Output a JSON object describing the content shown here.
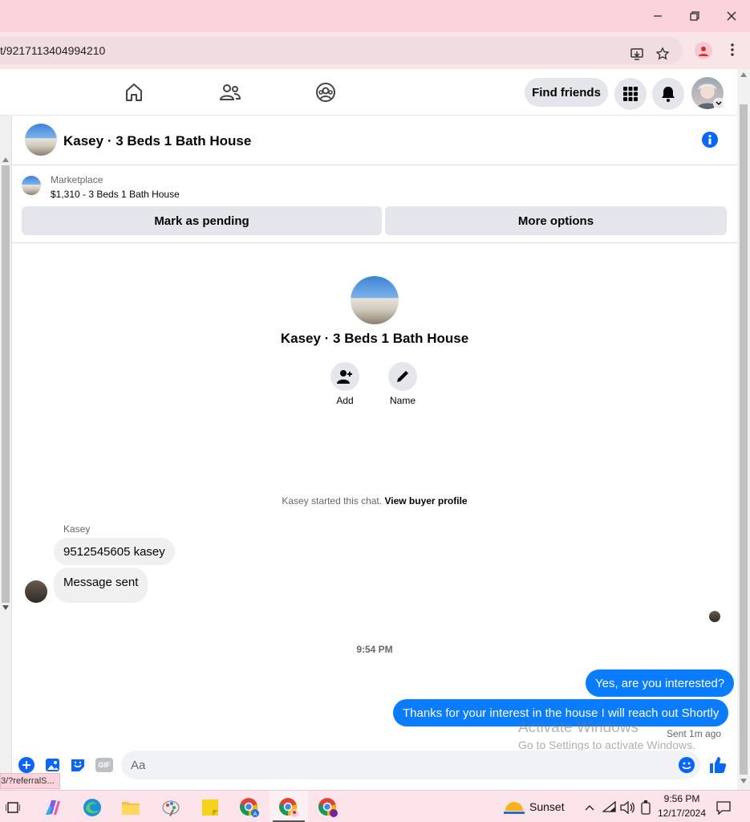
{
  "browser": {
    "url": "t/9217113404994210",
    "status_link": "3/?referralS..."
  },
  "fbnav": {
    "find_friends": "Find friends"
  },
  "chat": {
    "title": "Kasey · 3 Beds 1 Bath House",
    "marketplace_label": "Marketplace",
    "listing": "$1,310 - 3 Beds 1 Bath House",
    "mark_pending": "Mark as pending",
    "more_options": "More options",
    "profile_name": "Kasey · 3 Beds 1 Bath House",
    "add_label": "Add",
    "name_label": "Name",
    "started_text": "Kasey started this chat.",
    "view_buyer": "View buyer profile",
    "sender_name": "Kasey",
    "messages_in": [
      "9512545605 kasey",
      "Message sent"
    ],
    "time_divider": "9:54 PM",
    "messages_out": [
      "Yes, are you interested?",
      "Thanks for your interest in the house I will reach out Shortly"
    ],
    "sent_status": "Sent 1m ago",
    "composer_placeholder": "Aa"
  },
  "watermark": {
    "line1": "Activate Windows",
    "line2": "Go to Settings to activate Windows."
  },
  "taskbar": {
    "weather": "Sunset",
    "time": "9:56 PM",
    "date": "12/17/2024"
  },
  "colors": {
    "accent": "#0a7cff",
    "fb_blue": "#0866ff",
    "titlebar": "#fbd3dc"
  }
}
